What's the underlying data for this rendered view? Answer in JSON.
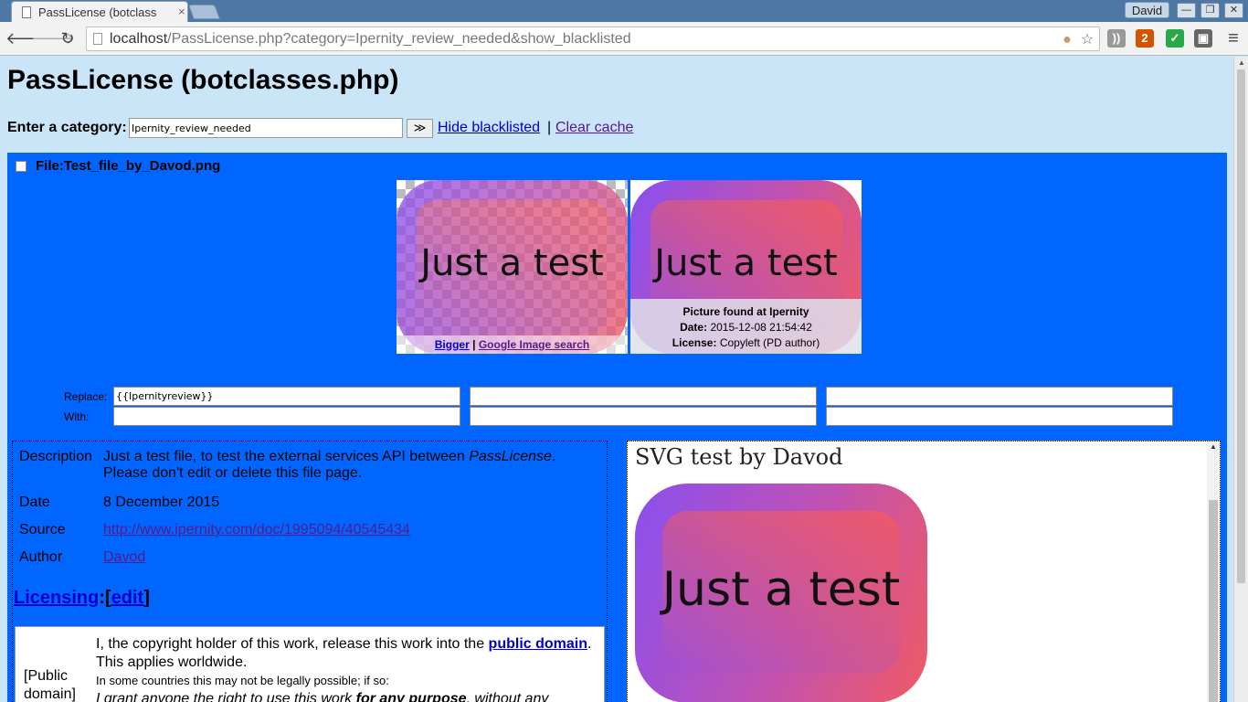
{
  "browser": {
    "tab_title": "PassLicense (botclass",
    "tab_close": "×",
    "user_name": "David",
    "win_minimize": "—",
    "win_restore": "❐",
    "win_close": "✕",
    "url_host": "localhost",
    "url_rest": "/PassLicense.php?category=Ipernity_review_needed&show_blacklisted",
    "back_icon": "🡐",
    "forward_icon": "🡒",
    "reload_icon": "↻",
    "star_icon": "☆",
    "menu_icon": "≡",
    "ext_badge": "2"
  },
  "page": {
    "title": "PassLicense (botclasses.php)",
    "category_label": "Enter a category:",
    "category_value": "Ipernity_review_needed",
    "go_button": "≫",
    "hide_blacklisted": "Hide blacklisted",
    "separator": "|",
    "clear_cache": "Clear cache"
  },
  "file": {
    "name": "File:Test_file_by_Davod.png",
    "thumb_text": "Just a test",
    "bigger_link": "Bigger",
    "link_sep": "|",
    "google_link": "Google Image search",
    "info_line1": "Picture found at Ipernity",
    "info_date_label": "Date:",
    "info_date": "2015-12-08 21:54:42",
    "info_license_label": "License:",
    "info_license": "Copyleft (PD author)"
  },
  "replace": {
    "replace_label": "Replace:",
    "with_label": "With:",
    "replace_1": "{{Ipernityreview}}",
    "replace_2": "",
    "replace_3": "",
    "with_1": "",
    "with_2": "",
    "with_3": ""
  },
  "description": {
    "desc_key": "Description",
    "desc_line1_a": "Just a test file, to test the external services API between ",
    "desc_line1_em": "PassLicense",
    "desc_line1_b": ".",
    "desc_line2": "Please don't edit or delete this file page.",
    "date_key": "Date",
    "date_val": "8 December 2015",
    "source_key": "Source",
    "source_val": "http://www.ipernity.com/doc/1995094/40545434",
    "author_key": "Author",
    "author_val": "Davod",
    "licensing_link": "Licensing",
    "licensing_colon": ":[",
    "edit_link": "edit",
    "licensing_close": "]",
    "pd_label_1": "[Public",
    "pd_label_2": "domain]",
    "lic_text_a": "I, the copyright holder of this work, release this work into the ",
    "lic_link": "public domain",
    "lic_text_b": ".",
    "lic_text_c": "This applies worldwide.",
    "lic_small": "In some countries this may not be legally possible; if so:",
    "lic_italic_a": "I grant anyone the right to use this work ",
    "lic_italic_b": "for any purpose",
    "lic_italic_c": ", without any"
  },
  "preview": {
    "title": "SVG test by Davod",
    "image_text": "Just a test"
  }
}
